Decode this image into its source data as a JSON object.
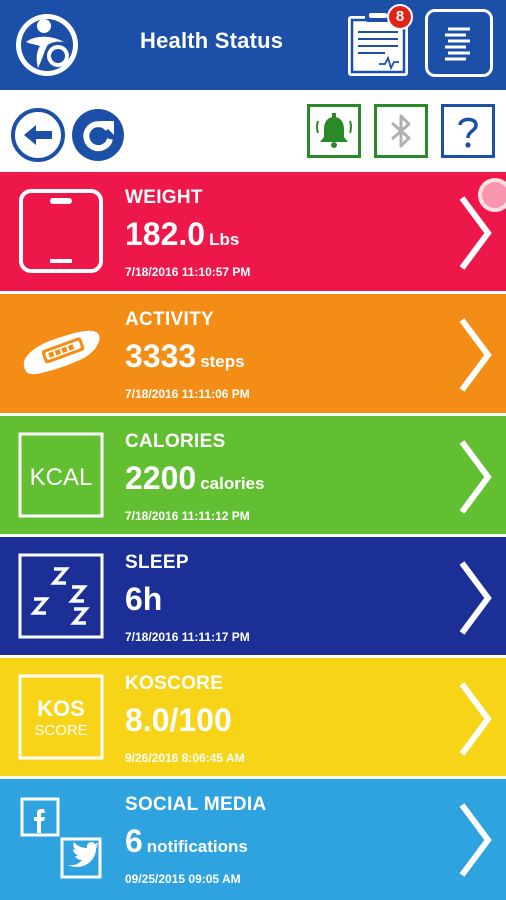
{
  "header": {
    "title": "Health Status",
    "badge_count": "8",
    "logo_icon": "person-logo-icon",
    "clipboard_icon": "clipboard-report-icon",
    "menu_icon": "menu-list-icon"
  },
  "toolbar": {
    "back_icon": "back-arrow-icon",
    "refresh_icon": "refresh-icon",
    "bell_icon": "bell-icon",
    "bluetooth_icon": "bluetooth-icon",
    "help_icon": "help-question-icon"
  },
  "tiles": [
    {
      "title": "WEIGHT",
      "value": "182.0",
      "unit": "Lbs",
      "time": "7/18/2016 11:10:57 PM",
      "color": "#ee1749",
      "icon": "scale-icon"
    },
    {
      "title": "ACTIVITY",
      "value": "3333",
      "unit": "steps",
      "time": "7/18/2016 11:11:06 PM",
      "color": "#f48d15",
      "icon": "activity-band-icon"
    },
    {
      "title": "CALORIES",
      "value": "2200",
      "unit": "calories",
      "time": "7/18/2016 11:11:12 PM",
      "color": "#62bf31",
      "icon": "kcal-icon",
      "icon_text": "KCAL"
    },
    {
      "title": "SLEEP",
      "value": "6h",
      "unit": "",
      "time": "7/18/2016 11:11:17 PM",
      "color": "#1b2f96",
      "icon": "sleep-zzz-icon"
    },
    {
      "title": "KOSCORE",
      "value": "8.0/100",
      "unit": "",
      "time": "9/26/2016 8:06:45 AM",
      "color": "#f7d417",
      "icon": "kos-score-icon",
      "icon_text_1": "KOS",
      "icon_text_2": "SCORE"
    },
    {
      "title": "SOCIAL MEDIA",
      "value": "6",
      "unit": "notifications",
      "time": "09/25/2015 09:05 AM",
      "color": "#2ea3df",
      "icon": "social-media-icon"
    }
  ]
}
